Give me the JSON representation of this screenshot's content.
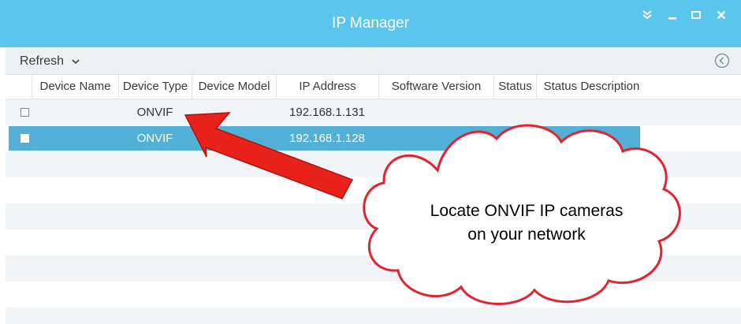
{
  "window": {
    "title": "IP Manager",
    "controls": [
      "collapse-double-chevron",
      "minimize",
      "maximize",
      "close"
    ]
  },
  "toolbar": {
    "refresh_label": "Refresh",
    "refresh_icon": "chevron-down-icon",
    "collapse_icon": "chevron-left-circle-icon"
  },
  "table": {
    "columns": [
      "Device Name",
      "Device Type",
      "Device Model",
      "IP Address",
      "Software Version",
      "Status",
      "Status Description"
    ],
    "rows": [
      {
        "checked": false,
        "device_name": "",
        "device_type": "ONVIF",
        "device_model": "",
        "ip_address": "192.168.1.131",
        "software_version": "",
        "status": "",
        "status_description": "",
        "selected": false
      },
      {
        "checked": false,
        "device_name": "",
        "device_type": "ONVIF",
        "device_model": "",
        "ip_address": "192.168.1.128",
        "software_version": "",
        "status": "",
        "status_description": "",
        "selected": true
      }
    ]
  },
  "callout": {
    "text_line1": "Locate ONVIF IP cameras",
    "text_line2": "on your network"
  },
  "colors": {
    "titlebar": "#5ac6ee",
    "selected_row": "#52b0d6",
    "arrow": "#e8221b"
  }
}
